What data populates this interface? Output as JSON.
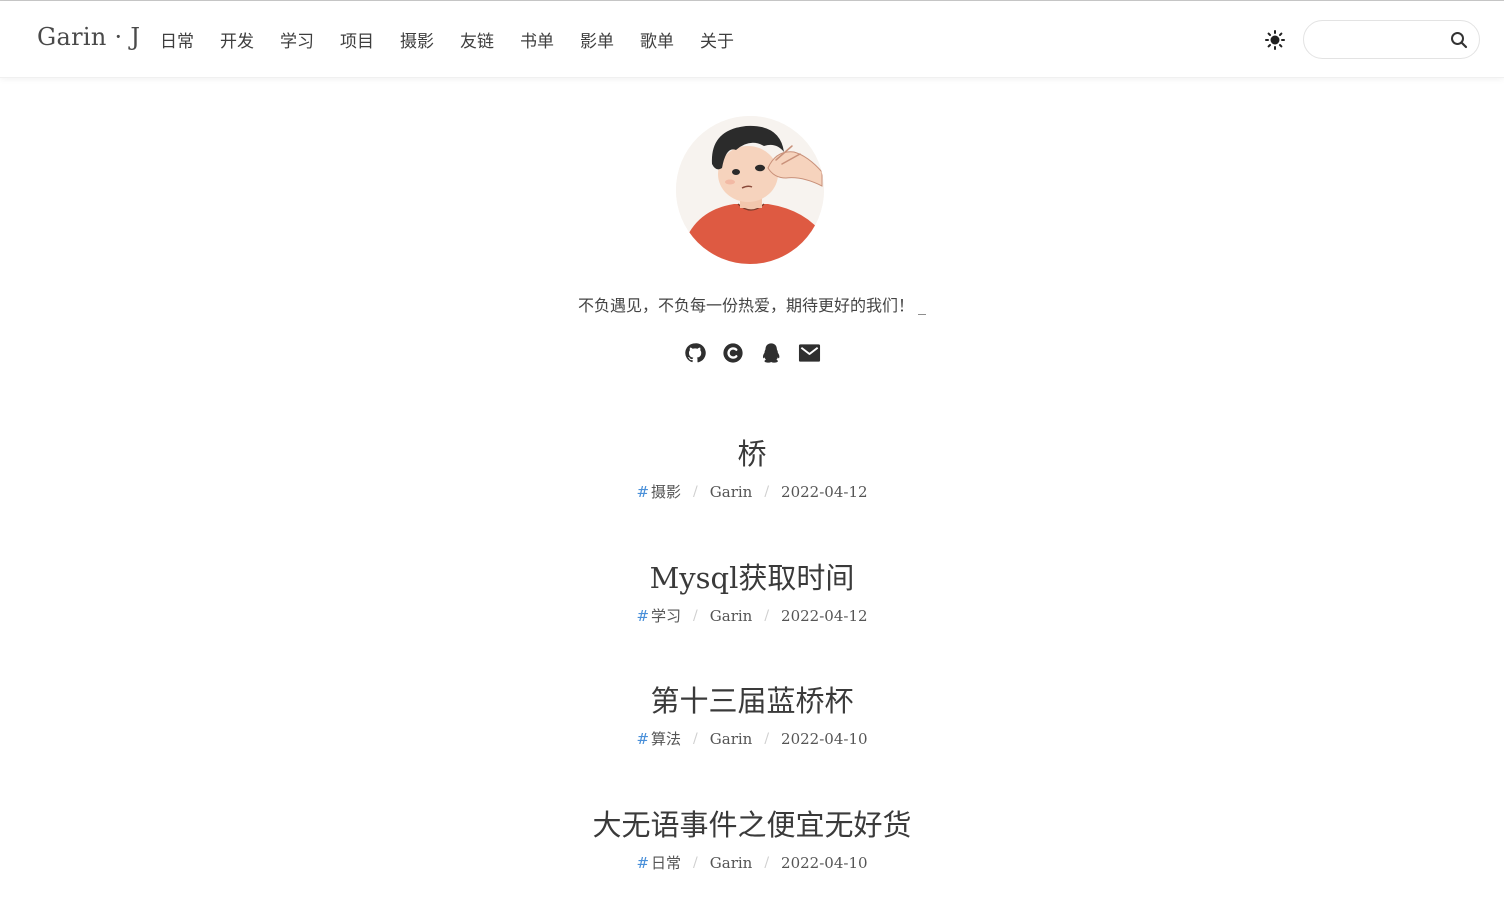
{
  "site": {
    "brand": "Garin · J"
  },
  "nav": {
    "items": [
      "日常",
      "开发",
      "学习",
      "项目",
      "摄影",
      "友链",
      "书单",
      "影单",
      "歌单",
      "关于"
    ]
  },
  "search": {
    "placeholder": ""
  },
  "profile": {
    "tagline": "不负遇见，不负每一份热爱，期待更好的我们！",
    "cursor": "_"
  },
  "socials": [
    "github-icon",
    "csdn-icon",
    "qq-icon",
    "mail-icon"
  ],
  "posts": [
    {
      "title": "桥",
      "tag": "摄影",
      "author": "Garin",
      "date": "2022-04-12"
    },
    {
      "title": "Mysql获取时间",
      "tag": "学习",
      "author": "Garin",
      "date": "2022-04-12"
    },
    {
      "title": "第十三届蓝桥杯",
      "tag": "算法",
      "author": "Garin",
      "date": "2022-04-10"
    },
    {
      "title": "大无语事件之便宜无好货",
      "tag": "日常",
      "author": "Garin",
      "date": "2022-04-10"
    }
  ],
  "meta": {
    "hash": "#",
    "separator": "/"
  },
  "colors": {
    "accent": "#4a90d9",
    "text": "#3a3a3a",
    "avatar_shirt": "#e0553f"
  }
}
